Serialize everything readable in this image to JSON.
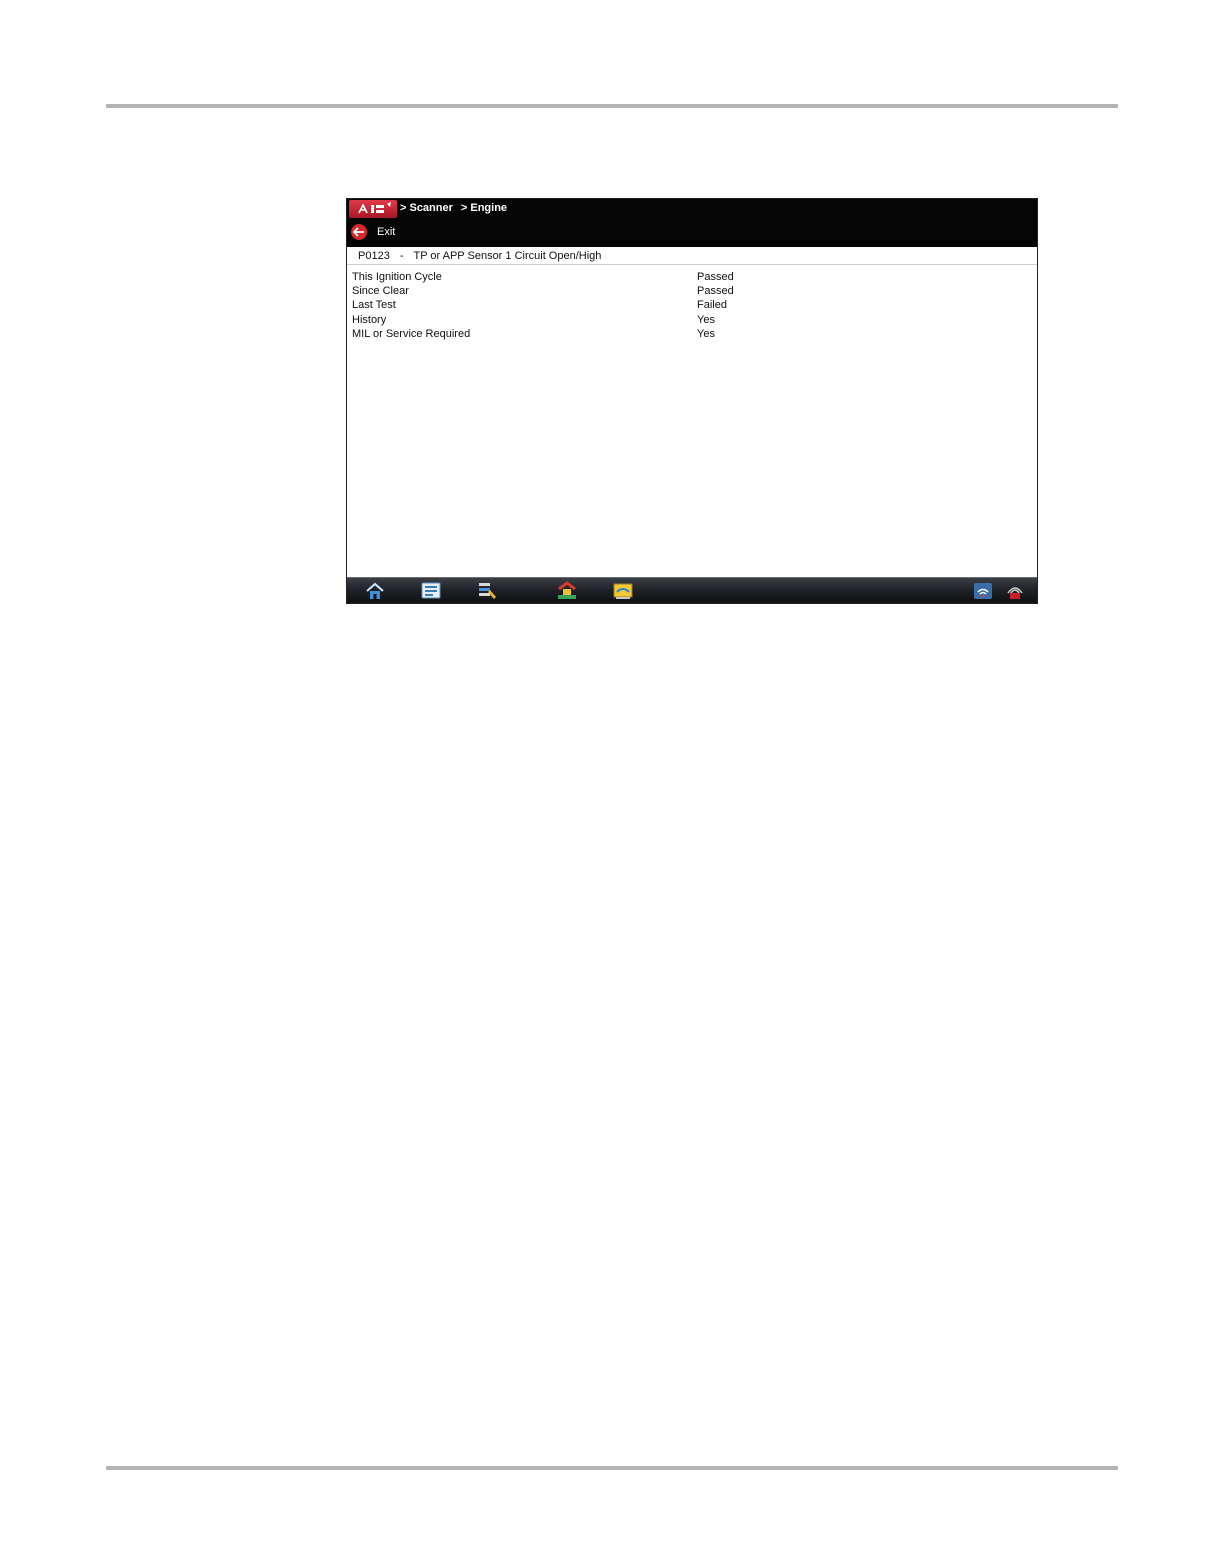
{
  "header": {
    "breadcrumb": [
      "> Scanner",
      "> Engine"
    ],
    "exit_label": "Exit"
  },
  "code": {
    "id": "P0123",
    "separator": "-",
    "description": "TP or APP Sensor 1 Circuit Open/High"
  },
  "status_rows": [
    {
      "label": "This Ignition Cycle",
      "value": "Passed"
    },
    {
      "label": "Since Clear",
      "value": "Passed"
    },
    {
      "label": "Last Test",
      "value": "Failed"
    },
    {
      "label": "History",
      "value": "Yes"
    },
    {
      "label": "MIL or Service Required",
      "value": "Yes"
    }
  ],
  "toolbar": {
    "icons": [
      "home-icon",
      "vehicle-id-icon",
      "tools-icon",
      "shop-icon",
      "data-manager-icon",
      "wifi-connection-icon",
      "vehicle-connection-icon"
    ]
  },
  "colors": {
    "title_bar": "#050505",
    "accent_red": "#c8202f",
    "text": "#111111"
  }
}
